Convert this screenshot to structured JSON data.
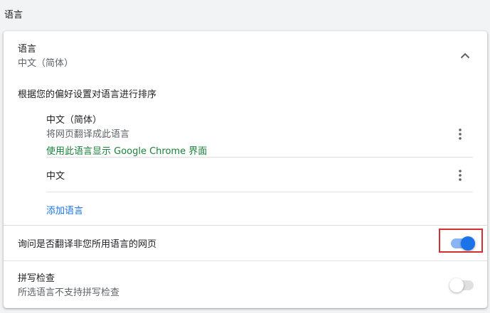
{
  "page": {
    "title": "语言"
  },
  "language_section": {
    "title": "语言",
    "current": "中文（简体）",
    "order_hint": "根据您的偏好设置对语言进行排序",
    "languages": [
      {
        "name": "中文（简体）",
        "translate_note": "将网页翻译成此语言",
        "display_note": "使用此语言显示 Google Chrome 界面"
      },
      {
        "name": "中文"
      }
    ],
    "add_language": "添加语言"
  },
  "translate_setting": {
    "label": "询问是否翻译非您所用语言的网页",
    "enabled": true
  },
  "spellcheck": {
    "title": "拼写检查",
    "subtitle": "所选语言不支持拼写检查",
    "enabled": false
  },
  "colors": {
    "accent": "#1a73e8",
    "green_link": "#188038",
    "highlight_border": "#d32f2f"
  },
  "icons": {
    "collapse": "chevron-up-icon",
    "more": "more-vert-icon"
  }
}
